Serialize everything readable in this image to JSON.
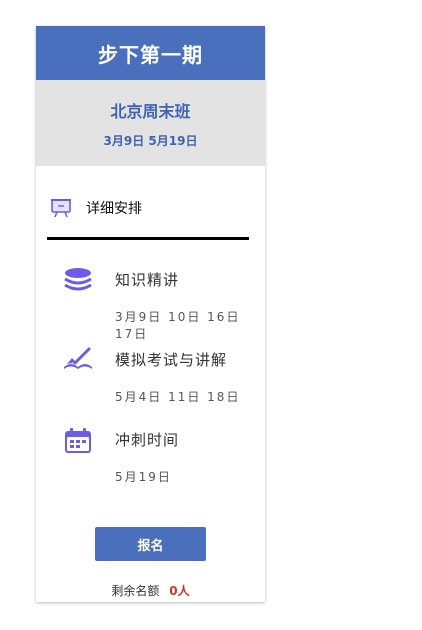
{
  "header": {
    "title": "步下第一期"
  },
  "event": {
    "location": "北京周末班",
    "dates": "3月9日 5月19日"
  },
  "details": {
    "label": "详细安排"
  },
  "agenda": [
    {
      "title": "知识精讲",
      "date": "3月9日 10日 16日 17日",
      "icon": "stack-icon"
    },
    {
      "title": "模拟考试与讲解",
      "date": "5月4日 11日 18日",
      "icon": "writing-icon"
    },
    {
      "title": "冲刺时间",
      "date": "5月19日",
      "icon": "calendar-icon"
    }
  ],
  "signup": {
    "button_label": "报名",
    "count_label": "剩余名额",
    "count_value": "0人"
  },
  "colors": {
    "primary": "#4a70bd",
    "icon_purple": "#6d5ce8",
    "count_red": "#c0392b"
  }
}
